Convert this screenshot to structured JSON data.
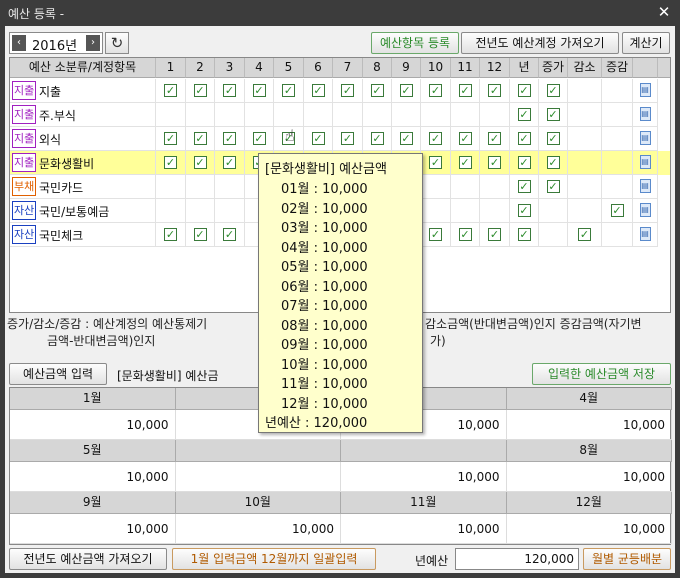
{
  "window": {
    "title": "예산 등록 -",
    "close_icon": "✕"
  },
  "toolbar": {
    "year": "2016년",
    "prev": "‹",
    "next": "›",
    "refresh": "↻",
    "btn_add_item": "예산항목 등록",
    "btn_load_prev": "전년도 예산계정 가져오기",
    "btn_calc": "계산기"
  },
  "grid": {
    "headers": [
      "예산 소분류/계정항목",
      "1",
      "2",
      "3",
      "4",
      "5",
      "6",
      "7",
      "8",
      "9",
      "10",
      "11",
      "12",
      "년",
      "증가",
      "감소",
      "증감"
    ],
    "rows": [
      {
        "badge": "지출",
        "badge_color": "#a020c0",
        "name": "지출",
        "months": [
          1,
          1,
          1,
          1,
          1,
          1,
          1,
          1,
          1,
          1,
          1,
          1
        ],
        "year": 1,
        "inc": 1,
        "dec": 0,
        "net": 0
      },
      {
        "badge": "지출",
        "badge_color": "#a020c0",
        "name": "주.부식",
        "months": [
          0,
          0,
          0,
          0,
          0,
          0,
          0,
          0,
          0,
          0,
          0,
          0
        ],
        "year": 1,
        "inc": 1,
        "dec": 0,
        "net": 0
      },
      {
        "badge": "지출",
        "badge_color": "#a020c0",
        "name": "외식",
        "months": [
          1,
          1,
          1,
          1,
          1,
          1,
          1,
          1,
          1,
          1,
          1,
          1
        ],
        "year": 1,
        "inc": 1,
        "dec": 0,
        "net": 0
      },
      {
        "badge": "지출",
        "badge_color": "#a020c0",
        "name": "문화생활비",
        "months": [
          1,
          1,
          1,
          1,
          1,
          1,
          1,
          1,
          1,
          1,
          1,
          1
        ],
        "year": 1,
        "inc": 1,
        "dec": 0,
        "net": 0
      },
      {
        "badge": "부채",
        "badge_color": "#e06000",
        "name": "국민카드",
        "months": [
          0,
          0,
          0,
          0,
          0,
          0,
          0,
          0,
          0,
          0,
          0,
          0
        ],
        "year": 1,
        "inc": 1,
        "dec": 0,
        "net": 0
      },
      {
        "badge": "자산",
        "badge_color": "#1a40c0",
        "name": "국민/보통예금",
        "months": [
          0,
          0,
          0,
          0,
          0,
          0,
          0,
          0,
          0,
          0,
          0,
          0
        ],
        "year": 1,
        "inc": 0,
        "dec": 0,
        "net": 1
      },
      {
        "badge": "자산",
        "badge_color": "#1a40c0",
        "name": "국민체크",
        "months": [
          1,
          1,
          1,
          0,
          0,
          0,
          0,
          0,
          1,
          1,
          1,
          1
        ],
        "year": 1,
        "inc": 0,
        "dec": 1,
        "net": 0
      }
    ]
  },
  "description": {
    "line1_left": "증가/감소/증감 : 예산계정의 예산통제기",
    "line1_right": "감소금액(반대변금액)인지 증감금액(자기변",
    "line2_left": "금액-반대변금액)인지",
    "line2_right": "가)"
  },
  "budget": {
    "input_label": "예산금액 입력",
    "selected": "[문화생활비] 예산금",
    "save": "입력한 예산금액 저장",
    "months": [
      "1월",
      "",
      "",
      "4월",
      "5월",
      "",
      "",
      "8월",
      "9월",
      "10월",
      "11월",
      "12월"
    ],
    "values": [
      "10,000",
      "",
      "10,000",
      "10,000",
      "10,000",
      "",
      "10,000",
      "10,000",
      "10,000",
      "10,000",
      "10,000",
      "10,000"
    ]
  },
  "bottom": {
    "load_prev": "전년도 예산금액 가져오기",
    "fill": "1월 입력금액 12월까지 일괄입력",
    "annual_label": "년예산",
    "annual_value": "120,000",
    "equal": "월별 균등배분"
  },
  "tooltip": {
    "title": "[문화생활비] 예산금액",
    "lines": [
      "01월 : 10,000",
      "02월 : 10,000",
      "03월 : 10,000",
      "04월 : 10,000",
      "05월 : 10,000",
      "06월 : 10,000",
      "07월 : 10,000",
      "08월 : 10,000",
      "09월 : 10,000",
      "10월 : 10,000",
      "11월 : 10,000",
      "12월 : 10,000"
    ],
    "total": "년예산 : 120,000"
  }
}
